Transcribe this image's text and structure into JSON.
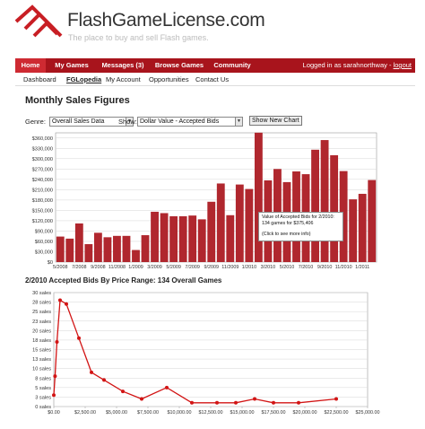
{
  "header": {
    "site_name": "FlashGameLicense.com",
    "tagline": "The place to buy and sell Flash games."
  },
  "topnav": {
    "items": [
      "Home",
      "My Games",
      "Messages (3)",
      "Browse Games",
      "Community"
    ],
    "active_index": 0,
    "login_text": "Logged in as sarahnorthway - ",
    "logout_label": "logout"
  },
  "subnav": {
    "items": [
      "Dashboard",
      "FGLopedia",
      "My Account",
      "Opportunities",
      "Contact Us"
    ],
    "active_index": 1
  },
  "main": {
    "title": "Monthly Sales Figures",
    "genre_label": "Genre:",
    "genre_value": "Overall Sales Data",
    "show_label": "Show:",
    "show_value": "Dollar Value - Accepted Bids",
    "show_button": "Show New Chart",
    "chart2_title": "2/2010 Accepted Bids By Price Range: 134 Overall Games"
  },
  "tooltip": {
    "line1": "Value of Accepted Bids for 2/2010:",
    "line2": "134 games for $375,406",
    "line3": "(Click to see more info)"
  },
  "colors": {
    "nav_red": "#a8141c",
    "nav_active": "#ce2a32",
    "bar_fill": "#b0272e",
    "line_color": "#d21414"
  },
  "chart_data": [
    {
      "type": "bar",
      "title": "",
      "xlabel": "",
      "ylabel": "",
      "ylim": [
        0,
        375000
      ],
      "y_ticks": [
        "$0",
        "$30,000",
        "$60,000",
        "$90,000",
        "$120,000",
        "$150,000",
        "$180,000",
        "$210,000",
        "$240,000",
        "$270,000",
        "$300,000",
        "$330,000",
        "$360,000"
      ],
      "x_ticks": [
        "5/2008",
        "7/2008",
        "9/2008",
        "11/2008",
        "1/2009",
        "3/2009",
        "5/2009",
        "7/2009",
        "9/2009",
        "11/2009",
        "1/2010",
        "3/2010",
        "5/2010",
        "7/2010",
        "9/2010",
        "11/2010",
        "1/2011"
      ],
      "categories": [
        "5/2008",
        "6/2008",
        "7/2008",
        "8/2008",
        "9/2008",
        "10/2008",
        "11/2008",
        "12/2008",
        "1/2009",
        "2/2009",
        "3/2009",
        "4/2009",
        "5/2009",
        "6/2009",
        "7/2009",
        "8/2009",
        "9/2009",
        "10/2009",
        "11/2009",
        "12/2009",
        "1/2010",
        "2/2010",
        "3/2010",
        "4/2010",
        "5/2010",
        "6/2010",
        "7/2010",
        "8/2010",
        "9/2010",
        "10/2010",
        "11/2010",
        "12/2010",
        "1/2011",
        "2/2011"
      ],
      "values": [
        74000,
        68000,
        112000,
        52000,
        85000,
        72000,
        76000,
        76000,
        35000,
        78000,
        146000,
        142000,
        133000,
        133000,
        135000,
        124000,
        175000,
        228000,
        136000,
        225000,
        212000,
        375406,
        237000,
        270000,
        232000,
        263000,
        255000,
        326000,
        354000,
        310000,
        264000,
        182000,
        198000,
        238000
      ],
      "grid": true,
      "legend": "none"
    },
    {
      "type": "line",
      "title": "2/2010 Accepted Bids By Price Range: 134 Overall Games",
      "xlabel": "",
      "ylabel": "",
      "xlim": [
        0,
        25000
      ],
      "ylim": [
        0,
        30
      ],
      "x_ticks": [
        "$0.00",
        "$2,500.00",
        "$5,000.00",
        "$7,500.00",
        "$10,000.00",
        "$12,500.00",
        "$15,000.00",
        "$17,500.00",
        "$20,000.00",
        "$22,500.00",
        "$25,000.00"
      ],
      "y_ticks": [
        "0 sales",
        "3 sales",
        "5 sales",
        "8 sales",
        "10 sales",
        "13 sales",
        "15 sales",
        "18 sales",
        "20 sales",
        "23 sales",
        "25 sales",
        "28 sales",
        "30 sales"
      ],
      "x": [
        0,
        100,
        250,
        500,
        1000,
        2000,
        3000,
        4000,
        5500,
        7000,
        9000,
        11000,
        13000,
        14500,
        16000,
        17500,
        19500,
        22500
      ],
      "y": [
        3,
        8,
        17,
        28,
        27,
        18,
        9,
        7,
        4,
        2,
        5,
        1,
        1,
        1,
        2,
        1,
        1,
        2
      ],
      "grid": true,
      "legend": "none"
    }
  ]
}
